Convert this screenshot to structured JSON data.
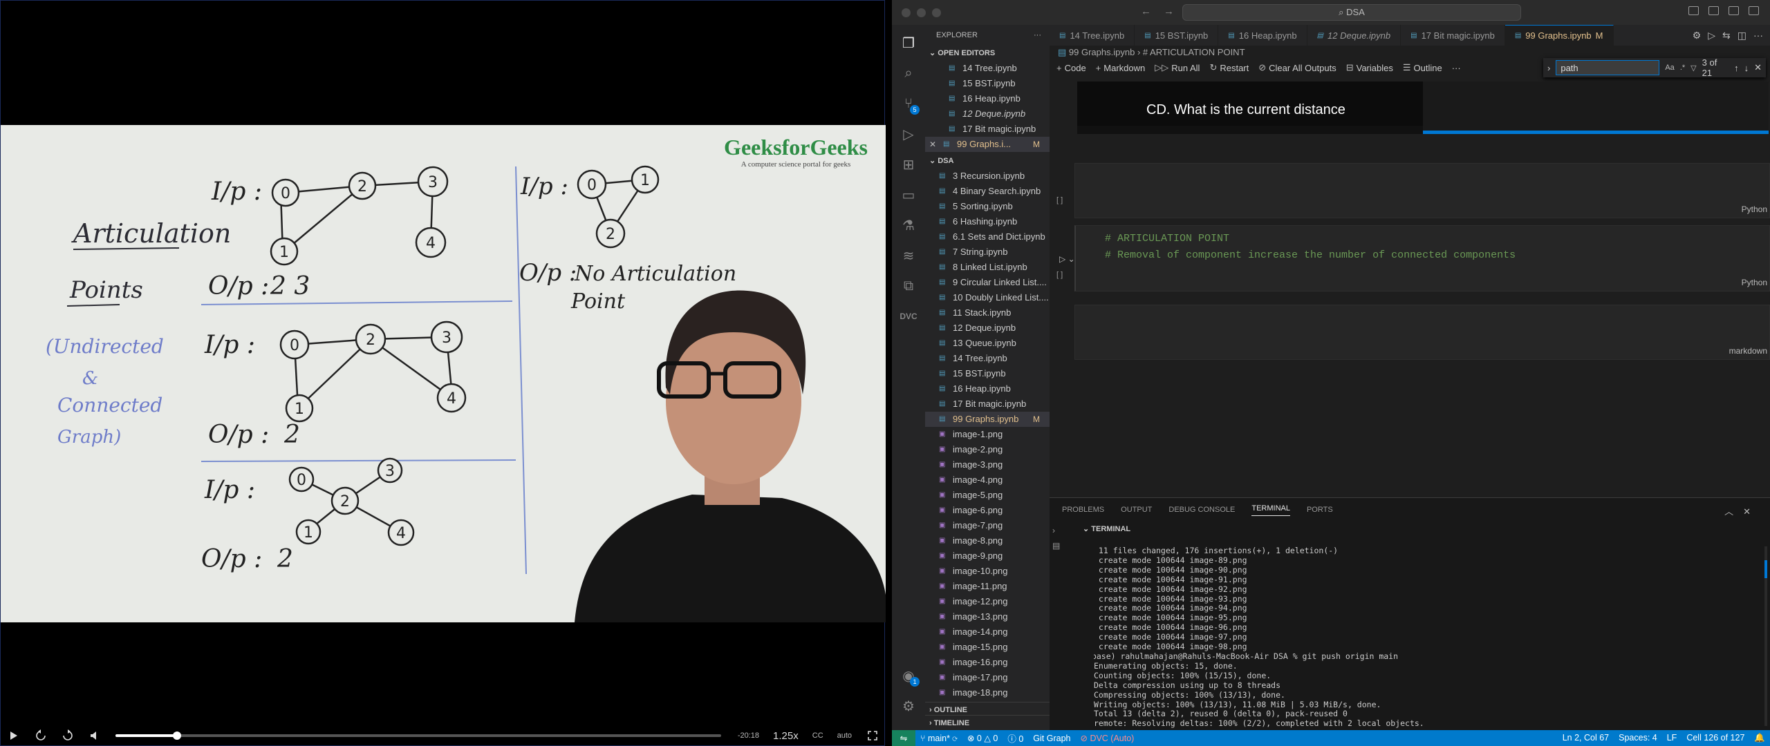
{
  "player": {
    "logo_name": "GeeksforGeeks",
    "logo_tagline": "A computer science portal for geeks",
    "progress_fraction": 0.102,
    "time_remaining": "-20:18",
    "speed": "1.25x",
    "cc_label": "CC",
    "quality": "auto",
    "whiteboard": {
      "title_line1": "Articulation",
      "title_line2": "Points",
      "note_line1": "(Undirected",
      "note_line2": "&",
      "note_line3": "Connected",
      "note_line4": "Graph)",
      "ip_label": "I/p :",
      "op_label": "O/p :",
      "ex1_output": "2  3",
      "ex2_output": "2",
      "ex3_output": "2",
      "ex4_output_line1": "No Articulation",
      "ex4_output_line2": "Point",
      "nodes": [
        "0",
        "1",
        "2",
        "3",
        "4"
      ]
    }
  },
  "vscode": {
    "search_text": "DSA",
    "explorer_title": "EXPLORER",
    "open_editors_title": "OPEN EDITORS",
    "open_editors": [
      {
        "name": "14 Tree.ipynb"
      },
      {
        "name": "15 BST.ipynb"
      },
      {
        "name": "16 Heap.ipynb"
      },
      {
        "name": "12 Deque.ipynb",
        "italic": true
      },
      {
        "name": "17 Bit magic.ipynb"
      },
      {
        "name": "99 Graphs.i...",
        "modified": "M",
        "active": true
      }
    ],
    "folder_title": "DSA",
    "files": [
      "3 Recursion.ipynb",
      "4 Binary Search.ipynb",
      "5 Sorting.ipynb",
      "6 Hashing.ipynb",
      "6.1 Sets and Dict.ipynb",
      "7 String.ipynb",
      "8 Linked List.ipynb",
      "9 Circular Linked List....",
      "10 Doubly Linked List....",
      "11 Stack.ipynb",
      "12 Deque.ipynb",
      "13 Queue.ipynb",
      "14 Tree.ipynb",
      "15 BST.ipynb",
      "16 Heap.ipynb",
      "17 Bit magic.ipynb"
    ],
    "selected_file": "99 Graphs.ipynb",
    "selected_flag": "M",
    "images": [
      "image-1.png",
      "image-2.png",
      "image-3.png",
      "image-4.png",
      "image-5.png",
      "image-6.png",
      "image-7.png",
      "image-8.png",
      "image-9.png",
      "image-10.png",
      "image-11.png",
      "image-12.png",
      "image-13.png",
      "image-14.png",
      "image-15.png",
      "image-16.png",
      "image-17.png",
      "image-18.png"
    ],
    "outline_title": "OUTLINE",
    "timeline_title": "TIMELINE",
    "source_control_badge": "5",
    "accounts_badge": "1",
    "tabs": [
      {
        "name": "14 Tree.ipynb"
      },
      {
        "name": "15 BST.ipynb"
      },
      {
        "name": "16 Heap.ipynb"
      },
      {
        "name": "12 Deque.ipynb",
        "italic": true
      },
      {
        "name": "17 Bit magic.ipynb"
      },
      {
        "name": "99 Graphs.ipynb",
        "flag": "M",
        "active": true
      }
    ],
    "breadcrumb_file": "99 Graphs.ipynb",
    "breadcrumb_section": "# ARTICULATION POINT",
    "toolbar": {
      "code": "Code",
      "markdown": "Markdown",
      "run_all": "Run All",
      "restart": "Restart",
      "clear_outputs": "Clear All Outputs",
      "variables": "Variables",
      "outline": "Outline",
      "more": "···"
    },
    "find": {
      "query": "path",
      "result": "3 of 21"
    },
    "mini_caption": "CD. What is the current distance",
    "cells": [
      {
        "exec": "[ ]",
        "lang": "Python",
        "code": ""
      },
      {
        "exec": "[ ]",
        "lang": "Python",
        "code": "# ARTICULATION POINT\n# Removal of component increase the number of connected components"
      },
      {
        "exec": "",
        "lang": "markdown",
        "code": ""
      }
    ],
    "panel_tabs": [
      "PROBLEMS",
      "OUTPUT",
      "DEBUG CONSOLE",
      "TERMINAL",
      "PORTS"
    ],
    "active_panel_tab": "TERMINAL",
    "terminal_title": "TERMINAL",
    "terminal_lines": [
      " 11 files changed, 176 insertions(+), 1 deletion(-)",
      " create mode 100644 image-89.png",
      " create mode 100644 image-90.png",
      " create mode 100644 image-91.png",
      " create mode 100644 image-92.png",
      " create mode 100644 image-93.png",
      " create mode 100644 image-94.png",
      " create mode 100644 image-95.png",
      " create mode 100644 image-96.png",
      " create mode 100644 image-97.png",
      " create mode 100644 image-98.png",
      "(base) rahulmahajan@Rahuls-MacBook-Air DSA % git push origin main",
      "Enumerating objects: 15, done.",
      "Counting objects: 100% (15/15), done.",
      "Delta compression using up to 8 threads",
      "Compressing objects: 100% (13/13), done.",
      "Writing objects: 100% (13/13), 11.08 MiB | 5.03 MiB/s, done.",
      "Total 13 (delta 2), reused 0 (delta 0), pack-reused 0",
      "remote: Resolving deltas: 100% (2/2), completed with 2 local objects."
    ],
    "status": {
      "branch": "main*",
      "errors": "0",
      "warnings": "0",
      "info": "0",
      "git_graph": "Git Graph",
      "dvc": "DVC (Auto)",
      "position": "Ln 2, Col 67",
      "spaces": "Spaces: 4",
      "eol": "LF",
      "cell": "Cell 126 of 127"
    }
  }
}
